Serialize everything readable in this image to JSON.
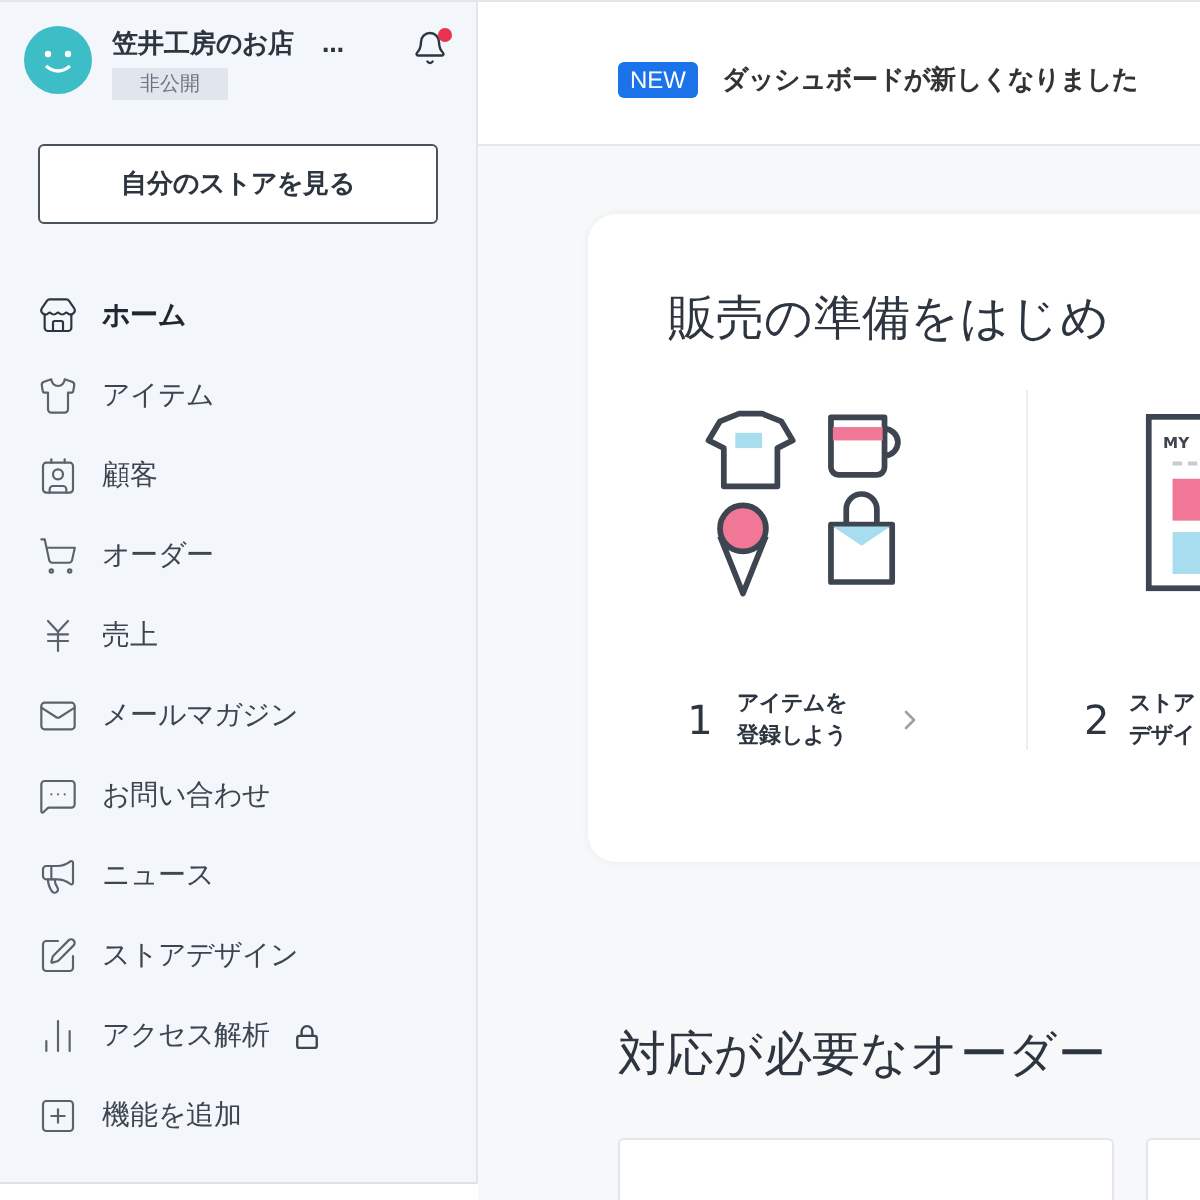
{
  "store": {
    "name": "笠井工房のお店",
    "more": "…",
    "status": "非公開",
    "notification": true
  },
  "view_store_button": "自分のストアを見る",
  "nav": [
    {
      "label": "ホーム",
      "selected": true
    },
    {
      "label": "アイテム",
      "selected": false
    },
    {
      "label": "顧客",
      "selected": false
    },
    {
      "label": "オーダー",
      "selected": false
    },
    {
      "label": "売上",
      "selected": false
    },
    {
      "label": "メールマガジン",
      "selected": false
    },
    {
      "label": "お問い合わせ",
      "selected": false
    },
    {
      "label": "ニュース",
      "selected": false
    },
    {
      "label": "ストアデザイン",
      "selected": false
    },
    {
      "label": "アクセス解析",
      "selected": false,
      "locked": true
    },
    {
      "label": "機能を追加",
      "selected": false
    }
  ],
  "banner": {
    "badge": "NEW",
    "text": "ダッシュボードが新しくなりました"
  },
  "setup": {
    "title": "販売の準備をはじめ",
    "steps": [
      {
        "number": "1",
        "lines": [
          "アイテムを",
          "登録しよう"
        ]
      },
      {
        "number": "2",
        "lines": [
          "ストア",
          "デザイ"
        ],
        "art_text": "MY"
      }
    ]
  },
  "orders": {
    "title": "対応が必要なオーダー"
  }
}
